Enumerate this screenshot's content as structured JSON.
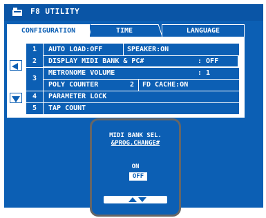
{
  "title": "F8 UTILITY",
  "tabs": [
    "CONFIGURATION",
    "TIME",
    "LANGUAGE"
  ],
  "rows": {
    "r1": {
      "num": "1",
      "a": "AUTO LOAD:OFF",
      "b": "SPEAKER:ON"
    },
    "r2": {
      "num": "2",
      "a": "DISPLAY MIDI BANK & PC#",
      "b": ": OFF"
    },
    "r3": {
      "num": "3",
      "a": "METRONOME VOLUME",
      "b": ": 1",
      "c": "POLY COUNTER",
      "d": "2",
      "e": "FD CACHE:ON"
    },
    "r4": {
      "num": "4",
      "a": "PARAMETER LOCK"
    },
    "r5": {
      "num": "5",
      "a": "TAP COUNT"
    }
  },
  "popup": {
    "line1": "MIDI BANK SEL.",
    "line2": "&PROG.CHANGE#",
    "option_on": "ON",
    "option_off": "OFF"
  },
  "colors": {
    "screen": "#0c5fb4",
    "popup_border": "#666666",
    "text": "#ffffff"
  },
  "icons": [
    "folder-icon",
    "arrow-up-icon",
    "arrow-down-icon",
    "up-down-arrows-icon"
  ]
}
